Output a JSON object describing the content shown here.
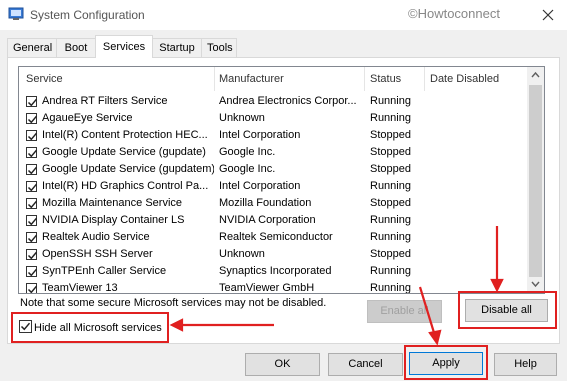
{
  "window": {
    "title": "System Configuration",
    "watermark": "©Howtoconnect",
    "close_glyph": "✕"
  },
  "tabs": [
    {
      "label": "General"
    },
    {
      "label": "Boot"
    },
    {
      "label": "Services",
      "active": true
    },
    {
      "label": "Startup"
    },
    {
      "label": "Tools"
    }
  ],
  "columns": {
    "service": "Service",
    "manufacturer": "Manufacturer",
    "status": "Status",
    "date_disabled": "Date Disabled"
  },
  "services": [
    {
      "name": "Andrea RT Filters Service",
      "manufacturer": "Andrea Electronics Corpor...",
      "status": "Running",
      "checked": true
    },
    {
      "name": "AgaueEye Service",
      "manufacturer": "Unknown",
      "status": "Running",
      "checked": true
    },
    {
      "name": "Intel(R) Content Protection HEC...",
      "manufacturer": "Intel Corporation",
      "status": "Stopped",
      "checked": true
    },
    {
      "name": "Google Update Service (gupdate)",
      "manufacturer": "Google Inc.",
      "status": "Stopped",
      "checked": true
    },
    {
      "name": "Google Update Service (gupdatem)",
      "manufacturer": "Google Inc.",
      "status": "Stopped",
      "checked": true
    },
    {
      "name": "Intel(R) HD Graphics Control Pa...",
      "manufacturer": "Intel Corporation",
      "status": "Running",
      "checked": true
    },
    {
      "name": "Mozilla Maintenance Service",
      "manufacturer": "Mozilla Foundation",
      "status": "Stopped",
      "checked": true
    },
    {
      "name": "NVIDIA Display Container LS",
      "manufacturer": "NVIDIA Corporation",
      "status": "Running",
      "checked": true
    },
    {
      "name": "Realtek Audio Service",
      "manufacturer": "Realtek Semiconductor",
      "status": "Running",
      "checked": true
    },
    {
      "name": "OpenSSH SSH Server",
      "manufacturer": "Unknown",
      "status": "Stopped",
      "checked": true
    },
    {
      "name": "SynTPEnh Caller Service",
      "manufacturer": "Synaptics Incorporated",
      "status": "Running",
      "checked": true
    },
    {
      "name": "TeamViewer 13",
      "manufacturer": "TeamViewer GmbH",
      "status": "Running",
      "checked": true
    }
  ],
  "note": "Note that some secure Microsoft services may not be disabled.",
  "buttons": {
    "enable_all": "Enable all",
    "disable_all": "Disable all",
    "ok": "OK",
    "cancel": "Cancel",
    "apply": "Apply",
    "help": "Help"
  },
  "hide_ms": {
    "label": "Hide all Microsoft services",
    "checked": true
  },
  "colors": {
    "highlight_red": "#e02020"
  }
}
